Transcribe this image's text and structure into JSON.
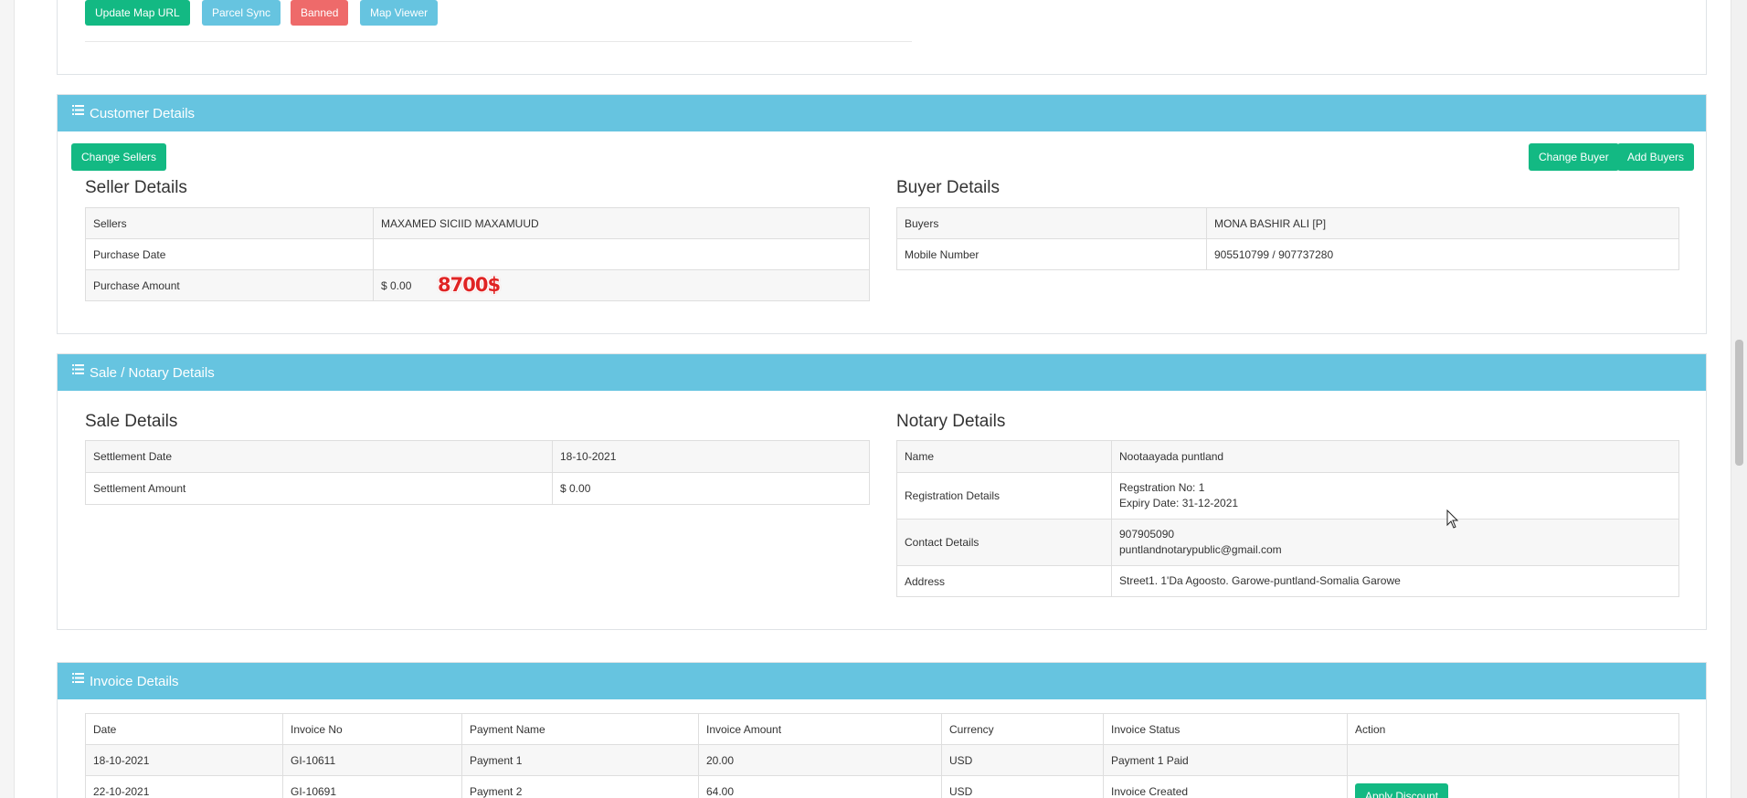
{
  "top_actions": {
    "update_map_url": "Update Map URL",
    "parcel_sync": "Parcel Sync",
    "banned": "Banned",
    "map_viewer": "Map Viewer"
  },
  "customer": {
    "title": "Customer Details",
    "change_sellers": "Change Sellers",
    "change_buyer": "Change Buyer",
    "add_buyers": "Add Buyers",
    "seller_heading": "Seller Details",
    "seller_rows": [
      {
        "label": "Sellers",
        "value": "MAXAMED SICIID MAXAMUUD"
      },
      {
        "label": "Purchase Date",
        "value": ""
      },
      {
        "label": "Purchase Amount",
        "value": "$ 0.00"
      }
    ],
    "handwritten_amount": "8700$",
    "buyer_heading": "Buyer Details",
    "buyer_rows": [
      {
        "label": "Buyers",
        "value": "MONA BASHIR ALI [P]"
      },
      {
        "label": "Mobile Number",
        "value": "905510799 / 907737280"
      }
    ]
  },
  "sale": {
    "title": "Sale / Notary Details",
    "sale_heading": "Sale Details",
    "sale_rows": [
      {
        "label": "Settlement Date",
        "value": "18-10-2021"
      },
      {
        "label": "Settlement Amount",
        "value": "$ 0.00"
      }
    ],
    "notary_heading": "Notary Details",
    "notary_rows": [
      {
        "label": "Name",
        "lines": [
          "Nootaayada puntland"
        ]
      },
      {
        "label": "Registration Details",
        "lines": [
          "Regstration No: 1",
          "Expiry Date: 31-12-2021"
        ]
      },
      {
        "label": "Contact Details",
        "lines": [
          "907905090",
          "puntlandnotarypublic@gmail.com"
        ]
      },
      {
        "label": "Address",
        "lines": [
          "Street1. 1'Da Agoosto. Garowe-puntland-Somalia Garowe"
        ]
      }
    ]
  },
  "invoice": {
    "title": "Invoice Details",
    "columns": [
      "Date",
      "Invoice No",
      "Payment Name",
      "Invoice Amount",
      "Currency",
      "Invoice Status",
      "Action"
    ],
    "rows": [
      {
        "date": "18-10-2021",
        "no": "GI-10611",
        "name": "Payment 1",
        "amount": "20.00",
        "currency": "USD",
        "status": "Payment 1 Paid",
        "action": ""
      },
      {
        "date": "22-10-2021",
        "no": "GI-10691",
        "name": "Payment 2",
        "amount": "64.00",
        "currency": "USD",
        "status": "Invoice Created",
        "action": "Apply Discount"
      }
    ]
  },
  "colors": {
    "panel_header": "#66c4e0",
    "button_green": "#13b983",
    "button_red": "#ee6a6a",
    "stamp_red": "#e02424"
  },
  "icons": [
    "list-icon",
    "mouse-cursor-icon"
  ]
}
